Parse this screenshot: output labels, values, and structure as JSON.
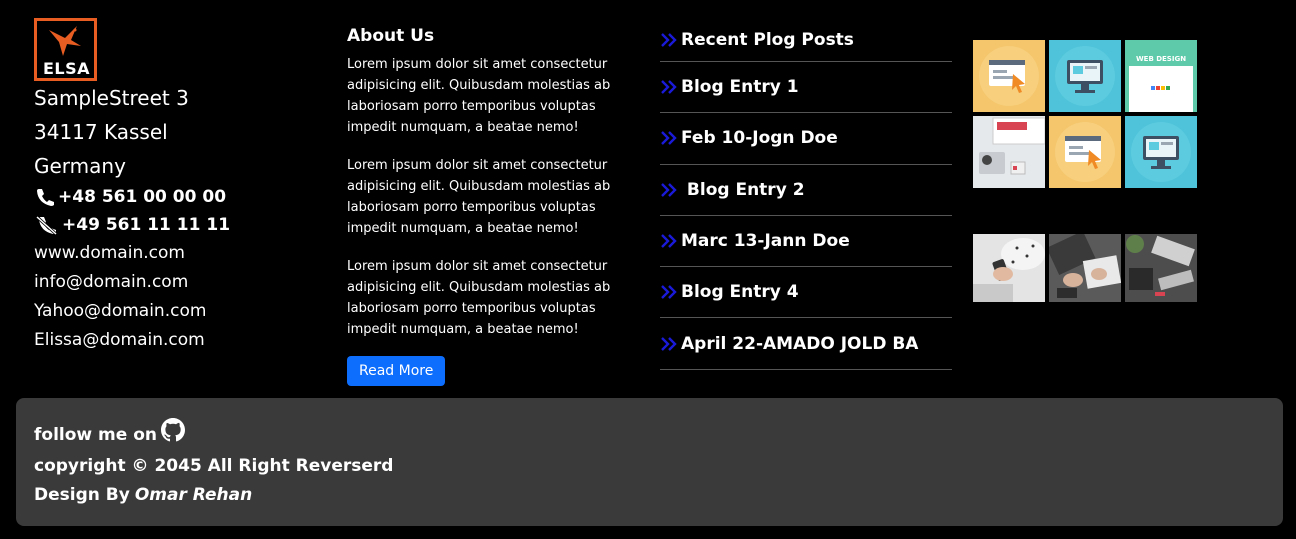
{
  "brand": {
    "logo_text": "ELSA",
    "accent": "#e85d22"
  },
  "contact": {
    "street": "SampleStreet 3",
    "city": "34117 Kassel",
    "country": "Germany",
    "phone": "+48 561 00 00 00",
    "fax": "+49 561 11 11 11",
    "web": "www.domain.com",
    "email1": "info@domain.com",
    "email2": "Yahoo@domain.com",
    "email3": "Elissa@domain.com"
  },
  "about": {
    "title": "About Us",
    "paragraphs": [
      "Lorem ipsum dolor sit amet consectetur adipisicing elit. Quibusdam molestias ab laboriosam porro temporibus voluptas impedit numquam, a beatae nemo!",
      "Lorem ipsum dolor sit amet consectetur adipisicing elit. Quibusdam molestias ab laboriosam porro temporibus voluptas impedit numquam, a beatae nemo!",
      "Lorem ipsum dolor sit amet consectetur adipisicing elit. Quibusdam molestias ab laboriosam porro temporibus voluptas impedit numquam, a beatae nemo!"
    ],
    "button": "Read More",
    "button_color": "#0d6efd"
  },
  "posts": {
    "title": "Recent Plog Posts",
    "items": [
      "Blog Entry 1",
      "Feb 10-Jogn Doe",
      " Blog Entry 2",
      "Marc 13-Jann Doe",
      "Blog Entry 4",
      "April 22-AMADO JOLD BA"
    ],
    "chevron_color": "#1a1ad8"
  },
  "gallery": {
    "icons": [
      "browser-cursor-thumb",
      "monitor-thumb",
      "web-design-thumb",
      "desk-photo-thumb",
      "browser-cursor-thumb",
      "monitor-thumb",
      "phone-hands-photo-thumb",
      "keyboard-photo-thumb",
      "desk-top-photo-thumb"
    ],
    "web_design_label": "WEB DESIGN"
  },
  "footer": {
    "follow": "follow me on",
    "copyright": "copyright © 2045 All Right Reverserd",
    "design_by": "Design By",
    "author": "Omar Rehan",
    "bg": "#3a3a3a"
  }
}
